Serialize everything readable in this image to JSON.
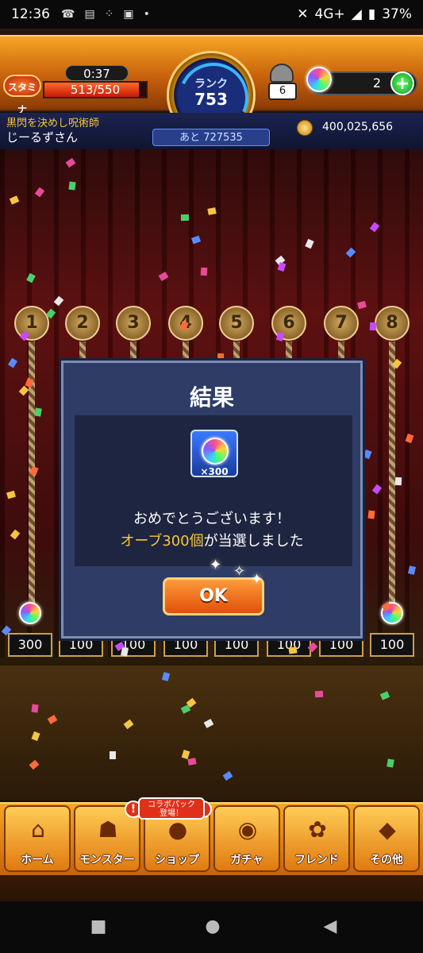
{
  "status_bar": {
    "time": "12:36",
    "icons": [
      "missed-call-icon",
      "city-alert-icon",
      "apps-icon",
      "photo-icon",
      "dot-icon"
    ],
    "right": {
      "mute": "mute-icon",
      "network": "4G+",
      "battery": "37%"
    }
  },
  "header": {
    "stamina": {
      "label": "スタミナ",
      "timer": "0:37",
      "value": "513/550",
      "fill_fraction": 0.93
    },
    "rank": {
      "label": "ランク",
      "value": "753",
      "next_label": "あと 727535"
    },
    "lamp": {
      "count": "6"
    },
    "orbs": {
      "count": "2",
      "plus_label": "+"
    },
    "player": {
      "title": "黒閃を決めし呪術師",
      "name": "じーるずさん"
    },
    "gold": {
      "value": "400,025,656"
    }
  },
  "stage": {
    "balls": [
      "1",
      "2",
      "3",
      "4",
      "5",
      "6",
      "7",
      "8"
    ],
    "prizes": [
      "300",
      "100",
      "100",
      "100",
      "100",
      "100",
      "100",
      "100"
    ]
  },
  "modal": {
    "title": "結果",
    "reward_qty": "×300",
    "message_line1": "おめでとうございます！",
    "message_highlight": "オーブ300個",
    "message_rest": "が当選しました",
    "ok_label": "OK"
  },
  "bottom_nav": {
    "collab_badge": "コラボパック\n登場！",
    "items": [
      {
        "label": "ホーム",
        "icon": "home-icon",
        "badge": ""
      },
      {
        "label": "モンスター",
        "icon": "monster-icon",
        "badge": "!"
      },
      {
        "label": "ショップ",
        "icon": "shop-orb-icon",
        "badge": "!"
      },
      {
        "label": "ガチャ",
        "icon": "gacha-icon",
        "badge": ""
      },
      {
        "label": "フレンド",
        "icon": "friend-icon",
        "badge": ""
      },
      {
        "label": "その他",
        "icon": "other-icon",
        "badge": ""
      }
    ]
  },
  "system_nav": {
    "recent": "recent-apps-icon",
    "home": "home-circle-icon",
    "back": "back-icon"
  },
  "colors": {
    "accent": "#f6a623",
    "modal_bg": "#2e3c66",
    "highlight": "#f5c542",
    "ok_button": "#e0500a"
  }
}
